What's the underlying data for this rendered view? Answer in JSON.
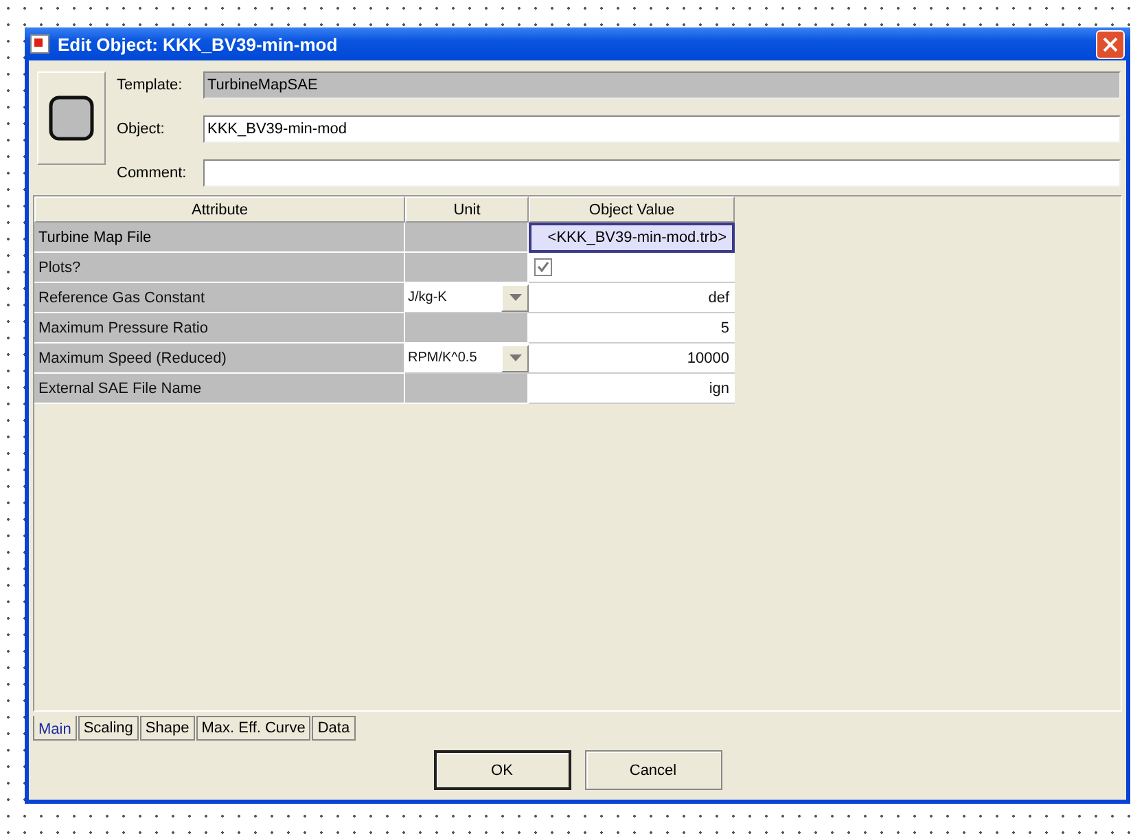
{
  "window": {
    "title": "Edit Object: KKK_BV39-min-mod"
  },
  "fields": [
    {
      "label": "Template:",
      "value": "TurbineMapSAE",
      "disabled": true
    },
    {
      "label": "Object:",
      "value": "KKK_BV39-min-mod",
      "disabled": false
    },
    {
      "label": "Comment:",
      "disabled": false
    }
  ],
  "table": {
    "columns": [
      "Attribute",
      "Unit",
      "Object Value"
    ],
    "rows": [
      {
        "attribute": "Turbine Map File",
        "kind": "text",
        "value": "<KKK_BV39-min-mod.trb>",
        "selected": true
      },
      {
        "attribute": "Plots?",
        "kind": "checkbox",
        "checked": true,
        "selected": false
      },
      {
        "attribute": "Reference Gas Constant",
        "unit": "J/kg-K",
        "kind": "text",
        "value": "def",
        "selected": false
      },
      {
        "attribute": "Maximum Pressure Ratio",
        "kind": "text",
        "value": "5",
        "selected": false
      },
      {
        "attribute": "Maximum Speed (Reduced)",
        "unit": "RPM/K^0.5",
        "kind": "text",
        "value": "10000",
        "selected": false
      },
      {
        "attribute": "External SAE File Name",
        "kind": "text",
        "value": "ign",
        "selected": false
      }
    ]
  },
  "tabs": [
    {
      "label": "Main",
      "selected": true
    },
    {
      "label": "Scaling",
      "selected": false
    },
    {
      "label": "Shape",
      "selected": false
    },
    {
      "label": "Max. Eff. Curve",
      "selected": false
    },
    {
      "label": "Data",
      "selected": false
    }
  ],
  "buttons": [
    "OK",
    "Cancel"
  ]
}
